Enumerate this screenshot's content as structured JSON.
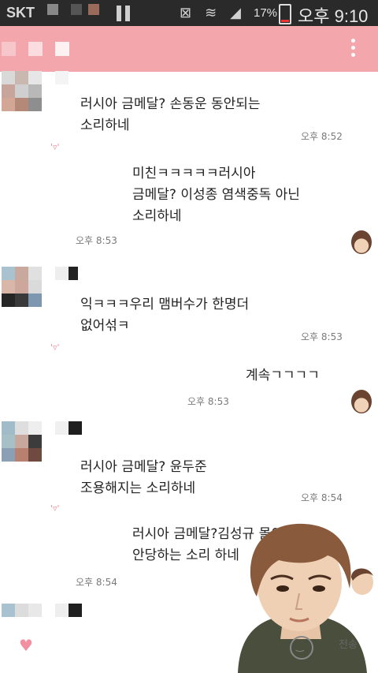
{
  "statusbar": {
    "carrier": "SKT",
    "battery": "17%",
    "time": "오후 9:10"
  },
  "colors": {
    "titlebar": "#f3a6ac",
    "status": "#2a2a2a",
    "accent": "#f08a98"
  },
  "header": {
    "menu_icon": "more-vert-icon"
  },
  "messages": [
    {
      "side": "left",
      "text": "러시아 금메달? 손동운 동안되는\n소리하네",
      "time": "오후 8:52"
    },
    {
      "side": "right",
      "text": "미친ㅋㅋㅋㅋㅋ러시아\n금메달? 이성종 염색중독 아닌\n소리하네",
      "time": "오후 8:53"
    },
    {
      "side": "left",
      "text": "익ㅋㅋㅋ우리 맴버수가 한명더\n없어섞ㅋ",
      "time": "오후 8:53"
    },
    {
      "side": "right",
      "text": "계속ㄱㄱㄱㄱ",
      "time": "오후 8:53"
    },
    {
      "side": "left",
      "text": "러시아 금메달? 윤두준\n조용해지는 소리하네",
      "time": "오후 8:54"
    },
    {
      "side": "right",
      "text": "러시아 금메달?김성규 몰이\n안당하는 소리 하네",
      "time": "오후 8:54"
    }
  ],
  "input": {
    "heart_icon": "heart-icon",
    "emoji_icon": "smiley-icon",
    "send_label": "전송"
  }
}
